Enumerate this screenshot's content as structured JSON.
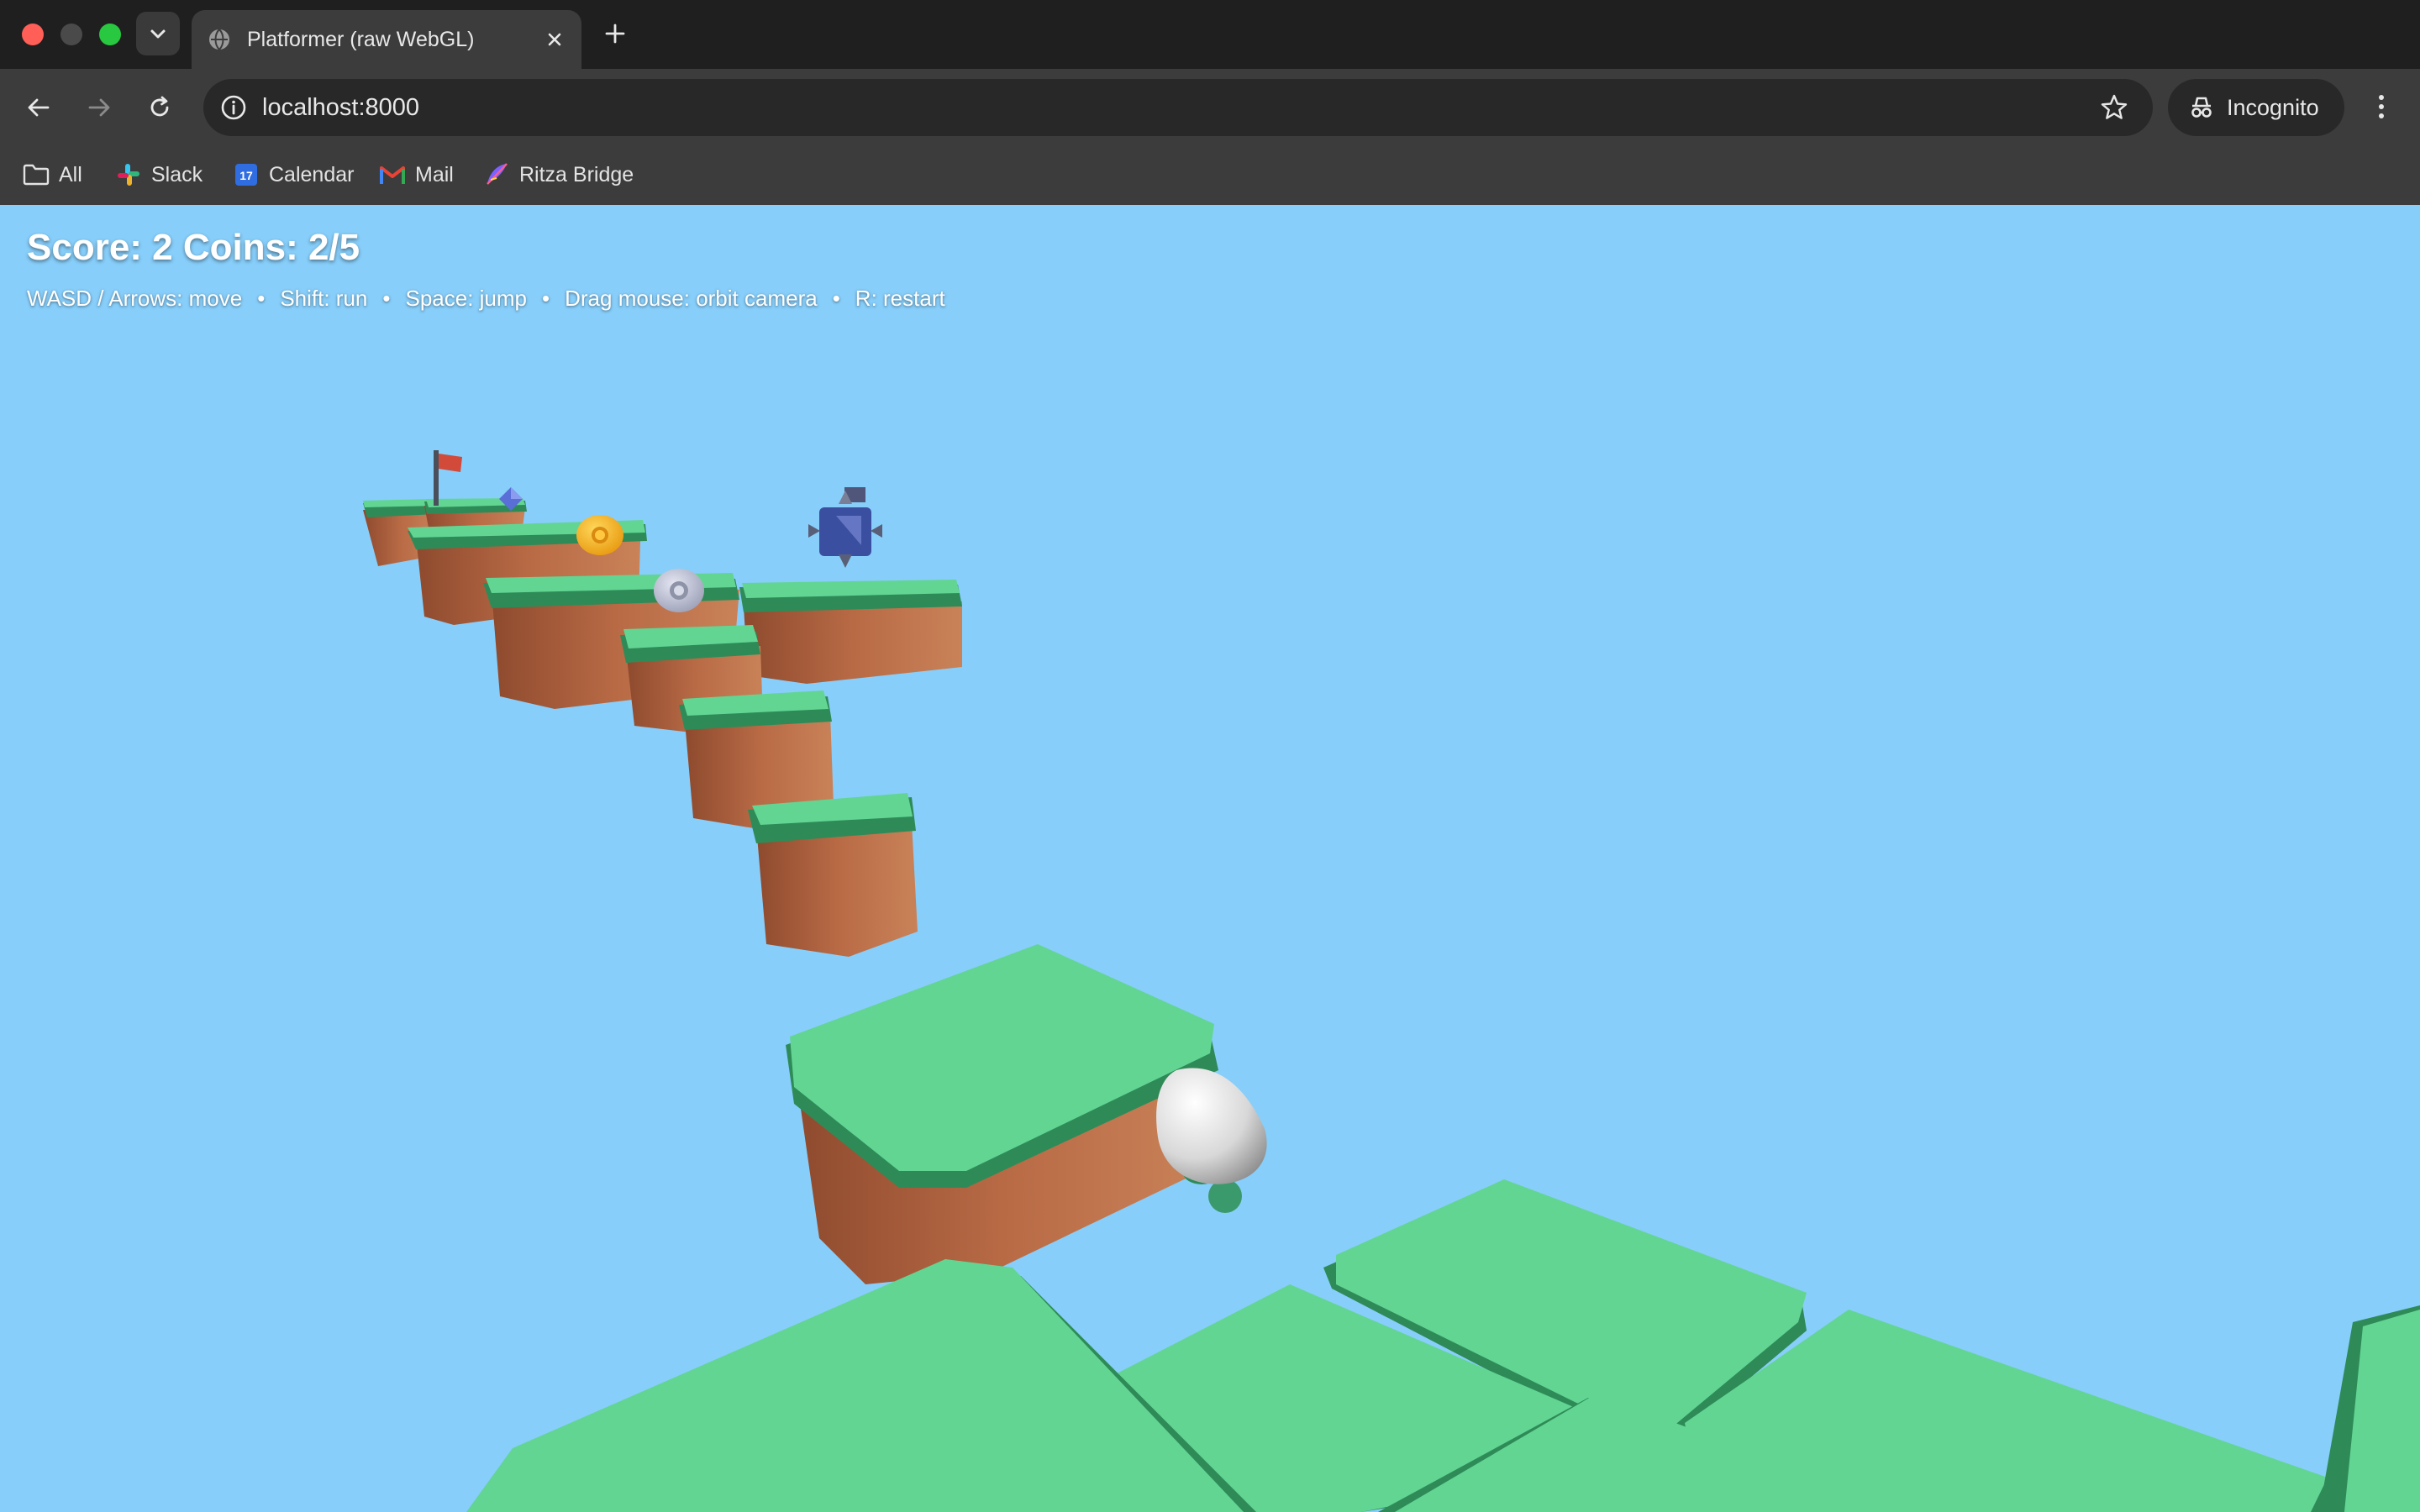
{
  "browser": {
    "tab": {
      "title": "Platformer (raw WebGL)"
    },
    "address": {
      "url": "localhost:8000"
    },
    "profile": {
      "label": "Incognito"
    },
    "bookmarks": [
      {
        "label": "All",
        "icon": "folder-icon"
      },
      {
        "label": "Slack",
        "icon": "slack-icon"
      },
      {
        "label": "Calendar",
        "icon": "calendar-icon",
        "badge": "17"
      },
      {
        "label": "Mail",
        "icon": "gmail-icon"
      },
      {
        "label": "Ritza Bridge",
        "icon": "feather-icon"
      }
    ]
  },
  "game": {
    "hud": {
      "score_text": "Score: 2 Coins: 2/5",
      "help": [
        "WASD / Arrows: move",
        "Shift: run",
        "Space: jump",
        "Drag mouse: orbit camera",
        "R: restart"
      ]
    },
    "colors": {
      "sky": "#87cefa",
      "grass_top": "#62d593",
      "grass_side": "#2e8b57",
      "dirt": "#b86a45",
      "coin_gold": "#f5b41e",
      "coin_silver": "#b8bcd0",
      "enemy": "#3a4fa0",
      "flag": "#d24a3a"
    }
  }
}
